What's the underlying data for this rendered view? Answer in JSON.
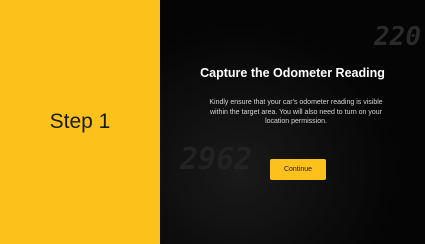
{
  "left_panel": {
    "step_label": "Step 1"
  },
  "right_panel": {
    "title": "Capture the Odometer Reading",
    "description": "Kindly ensure that your car's odometer reading is visible within the target area. You will also need to turn on your location permission.",
    "continue_label": "Continue",
    "background_readouts": {
      "top": "220",
      "middle": "2962"
    }
  },
  "colors": {
    "accent": "#fcc21b",
    "panel_dark": "#050505",
    "text_light": "#ffffff"
  }
}
